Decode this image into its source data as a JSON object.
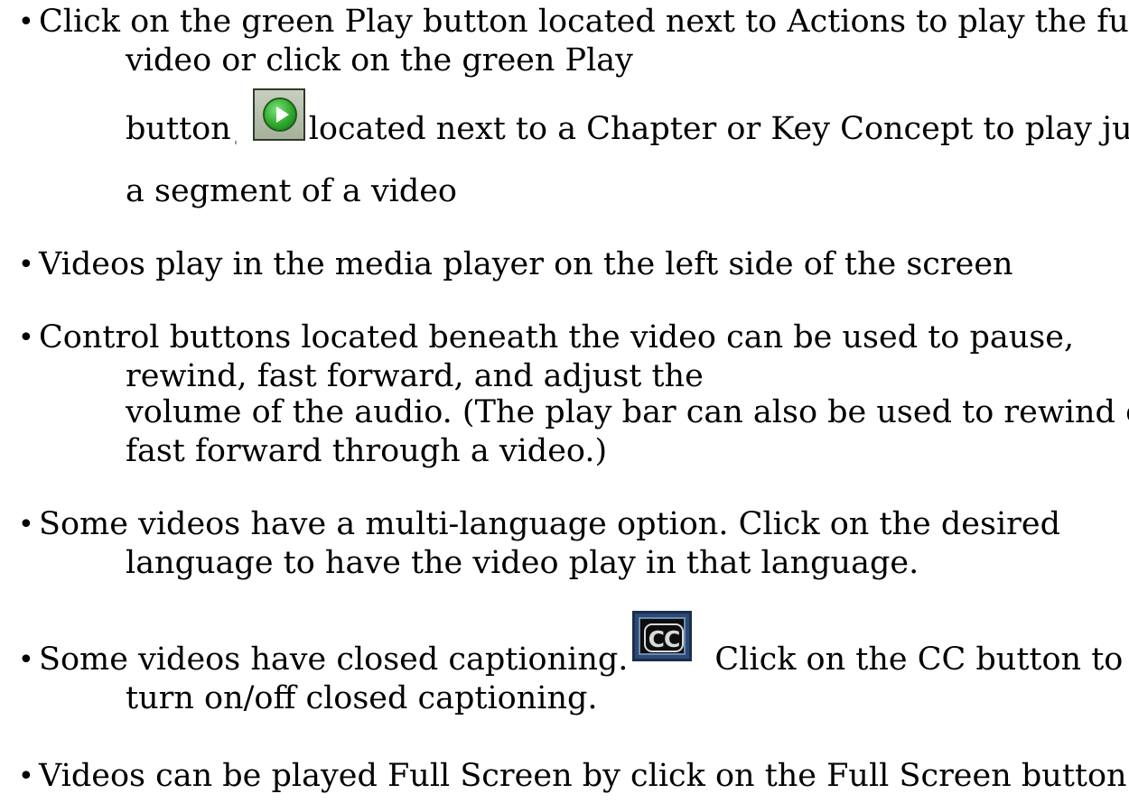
{
  "bullets": [
    {
      "lines": [
        "Click on the green Play button located next to Actions to play the full",
        "video or click on the green Play",
        "button",
        "located next to a Chapter or Key Concept to play just",
        "a segment of a video"
      ]
    },
    {
      "lines": [
        "Videos play in the media player on the left side of the screen"
      ]
    },
    {
      "lines": [
        "Control buttons located beneath the video can be used to pause,",
        "rewind, fast forward, and adjust the",
        "volume of the audio. (The play bar can also be used to rewind or",
        "fast forward through a video.)"
      ]
    },
    {
      "lines": [
        "Some videos have a multi-language option. Click on the desired",
        "language to have the video play in that language."
      ]
    },
    {
      "lines": [
        "Some videos have closed captioning.",
        "Click on the CC button to",
        "turn on/off closed captioning."
      ]
    },
    {
      "lines": [
        "Videos can be played Full Screen by click on the Full Screen button"
      ]
    }
  ],
  "icons": {
    "play": "play-button-icon",
    "cc": "closed-caption-icon",
    "cc_label": "CC"
  }
}
